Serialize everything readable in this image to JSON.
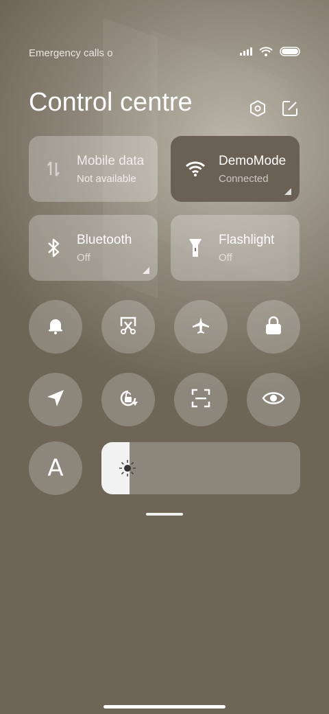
{
  "status_bar": {
    "left_text": "Emergency calls o",
    "icons": [
      "signal-icon",
      "wifi-icon",
      "battery-icon"
    ]
  },
  "header": {
    "title": "Control centre",
    "settings_icon": "settings-icon",
    "edit_icon": "edit-icon"
  },
  "tiles": [
    {
      "name": "mobile-data",
      "label": "Mobile data",
      "sub": "Not available",
      "icon": "mobile-data-icon",
      "active": false
    },
    {
      "name": "wifi",
      "label": "DemoMode",
      "sub": "Connected",
      "icon": "wifi-icon",
      "active": true
    },
    {
      "name": "bluetooth",
      "label": "Bluetooth",
      "sub": "Off",
      "icon": "bluetooth-icon",
      "active": false
    },
    {
      "name": "flashlight",
      "label": "Flashlight",
      "sub": "Off",
      "icon": "flashlight-icon",
      "active": false
    }
  ],
  "toggles_row1": [
    "bell-icon",
    "screenshot-icon",
    "airplane-icon",
    "lock-icon"
  ],
  "toggles_row2": [
    "location-icon",
    "rotation-lock-icon",
    "scanner-icon",
    "eye-icon"
  ],
  "font_button": {
    "label": "A"
  },
  "brightness": {
    "level": 0.14,
    "icon": "brightness-icon"
  }
}
